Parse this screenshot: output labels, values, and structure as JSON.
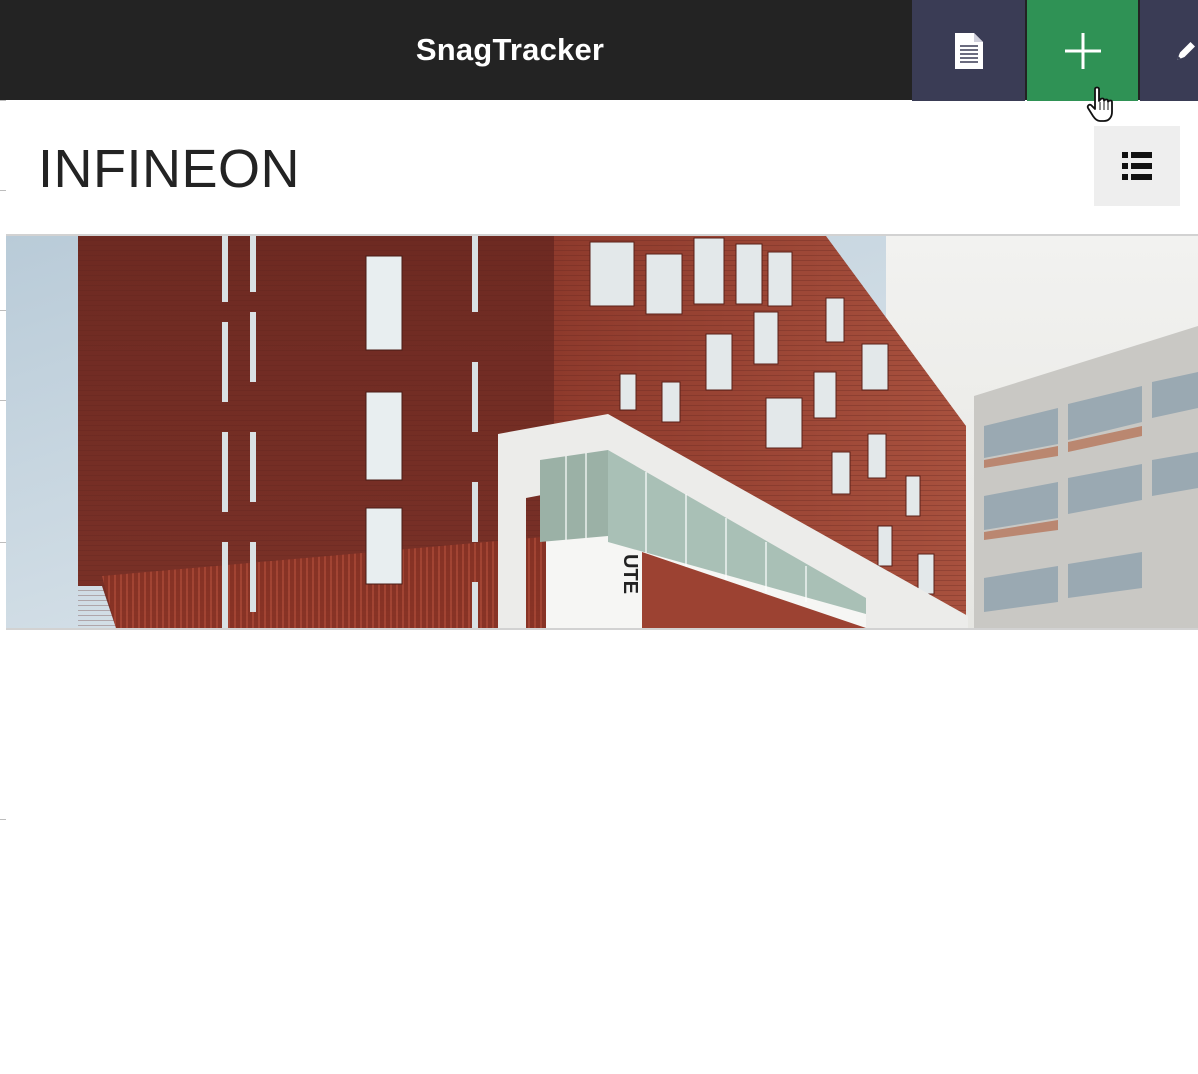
{
  "header": {
    "title_part1": "Snag",
    "title_part2": "g",
    "title_part3": "Tracker",
    "buttons": {
      "documents_icon": "document-icon",
      "add_icon": "plus-icon",
      "edit_icon": "pencil-icon"
    },
    "colors": {
      "bar": "#232323",
      "documents_button": "#3a3c55",
      "add_button": "#2f9255",
      "edit_button": "#3a3c55"
    }
  },
  "project": {
    "name": "INFINEON",
    "view_toggle_icon": "list-view-icon",
    "building_sign": "UTE"
  }
}
